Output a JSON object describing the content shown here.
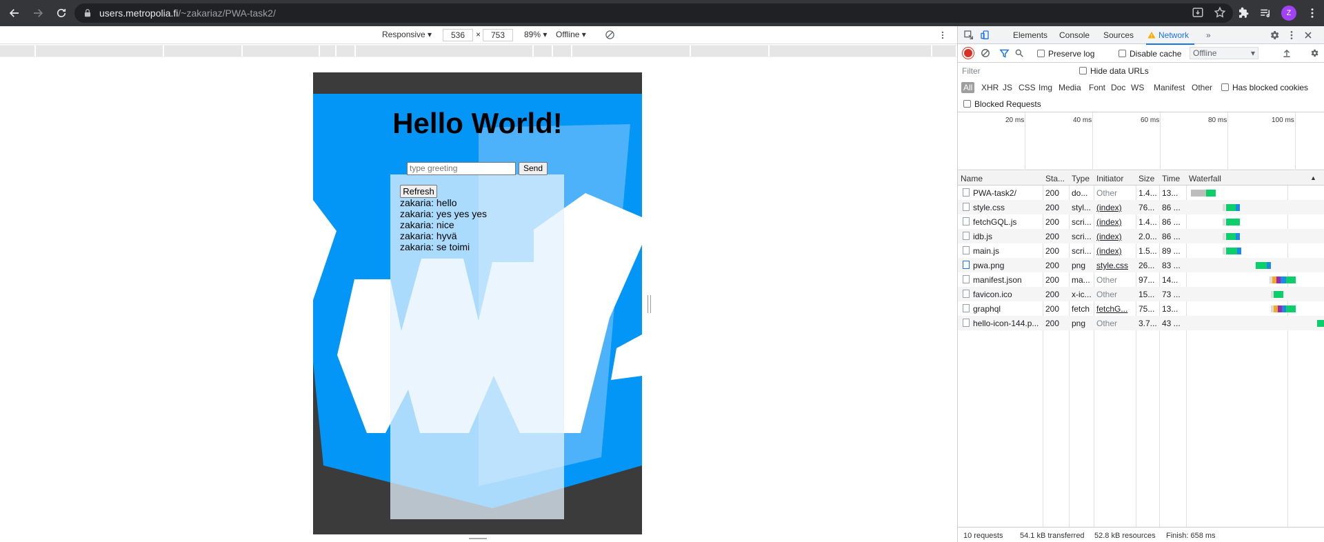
{
  "browser": {
    "url_host": "users.metropolia.fi",
    "url_path": "/~zakariaz/PWA-task2/",
    "avatar_letter": "Z"
  },
  "device_toolbar": {
    "mode": "Responsive",
    "width": "536",
    "times": "×",
    "height": "753",
    "zoom": "89%",
    "throttle": "Offline"
  },
  "page": {
    "heading": "Hello World!",
    "input_placeholder": "type greeting",
    "send_label": "Send",
    "refresh_label": "Refresh",
    "messages": [
      {
        "user": "zakaria:",
        "text": "hello"
      },
      {
        "user": "zakaria:",
        "text": "yes yes yes"
      },
      {
        "user": "zakaria:",
        "text": "nice"
      },
      {
        "user": "zakaria:",
        "text": "hyvä"
      },
      {
        "user": "zakaria:",
        "text": "se toimi"
      }
    ]
  },
  "devtools": {
    "tabs": [
      "Elements",
      "Console",
      "Sources",
      "Network"
    ],
    "active_tab": "Network",
    "toolbar": {
      "preserve_log": "Preserve log",
      "disable_cache": "Disable cache",
      "throttle": "Offline"
    },
    "filter_placeholder": "Filter",
    "hide_data_urls": "Hide data URLs",
    "types": [
      "All",
      "XHR",
      "JS",
      "CSS",
      "Img",
      "Media",
      "Font",
      "Doc",
      "WS",
      "Manifest",
      "Other"
    ],
    "has_blocked_cookies": "Has blocked cookies",
    "blocked_requests": "Blocked Requests",
    "overview_ticks": [
      "20 ms",
      "40 ms",
      "60 ms",
      "80 ms",
      "100 ms"
    ],
    "columns": [
      "Name",
      "Sta...",
      "Type",
      "Initiator",
      "Size",
      "Time",
      "Waterfall"
    ],
    "rows": [
      {
        "name": "PWA-task2/",
        "status": "200",
        "type": "do...",
        "initiator": "Other",
        "size": "1.4...",
        "time": "13..."
      },
      {
        "name": "style.css",
        "status": "200",
        "type": "styl...",
        "initiator": "(index)",
        "size": "76...",
        "time": "86 ..."
      },
      {
        "name": "fetchGQL.js",
        "status": "200",
        "type": "scri...",
        "initiator": "(index)",
        "size": "1.4...",
        "time": "86 ..."
      },
      {
        "name": "idb.js",
        "status": "200",
        "type": "scri...",
        "initiator": "(index)",
        "size": "2.0...",
        "time": "86 ..."
      },
      {
        "name": "main.js",
        "status": "200",
        "type": "scri...",
        "initiator": "(index)",
        "size": "1.5...",
        "time": "89 ..."
      },
      {
        "name": "pwa.png",
        "status": "200",
        "type": "png",
        "initiator": "style.css",
        "size": "26...",
        "time": "83 ..."
      },
      {
        "name": "manifest.json",
        "status": "200",
        "type": "ma...",
        "initiator": "Other",
        "size": "97...",
        "time": "14..."
      },
      {
        "name": "favicon.ico",
        "status": "200",
        "type": "x-ic...",
        "initiator": "Other",
        "size": "15...",
        "time": "73 ..."
      },
      {
        "name": "graphql",
        "status": "200",
        "type": "fetch",
        "initiator": "fetchG...",
        "size": "75...",
        "time": "13..."
      },
      {
        "name": "hello-icon-144.p...",
        "status": "200",
        "type": "png",
        "initiator": "Other",
        "size": "3.7...",
        "time": "43 ..."
      }
    ],
    "status": {
      "requests": "10 requests",
      "transferred": "54.1 kB transferred",
      "resources": "52.8 kB resources",
      "finish": "Finish: 658 ms"
    }
  }
}
